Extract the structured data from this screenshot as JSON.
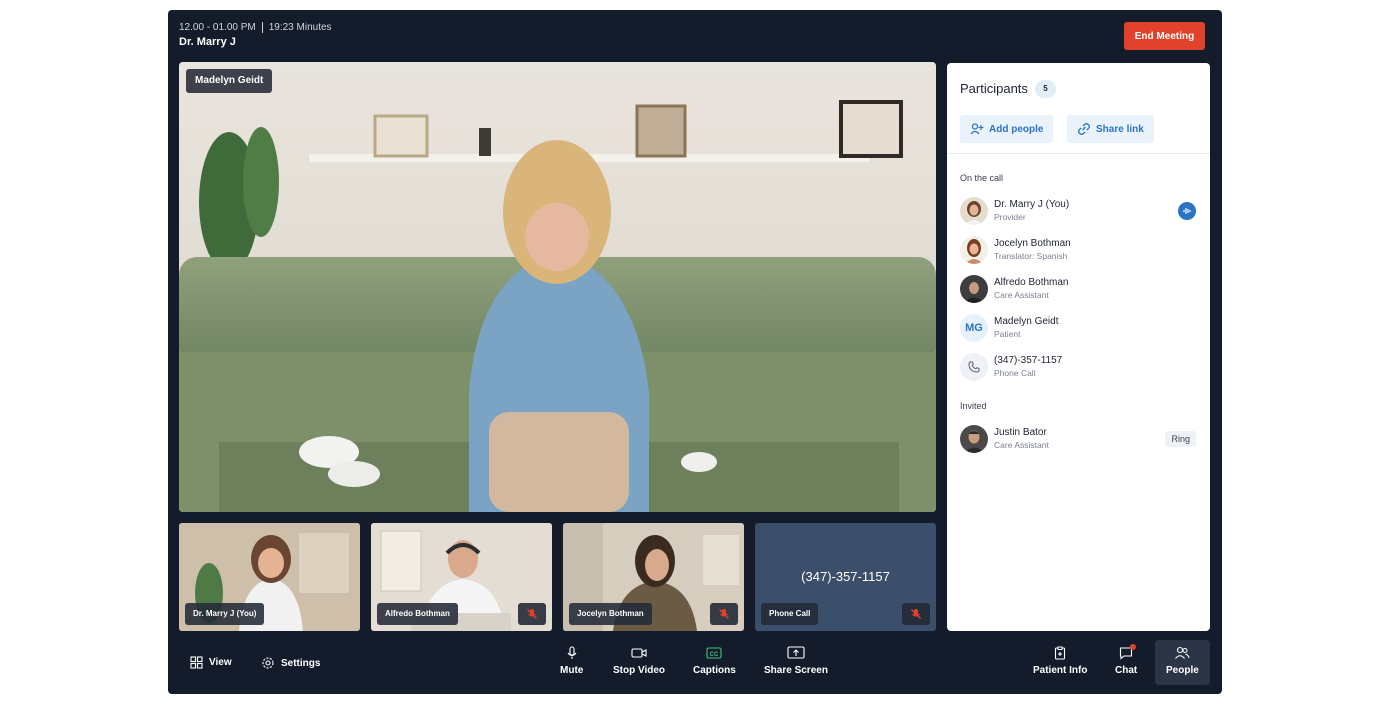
{
  "header": {
    "time_range": "12.00 - 01.00 PM",
    "duration": "19:23 Minutes",
    "host": "Dr. Marry J",
    "end_button": "End Meeting"
  },
  "main_video": {
    "name": "Madelyn Geidt"
  },
  "thumbnails": [
    {
      "name": "Dr. Marry J (You)",
      "muted": false
    },
    {
      "name": "Alfredo Bothman",
      "muted": true
    },
    {
      "name": "Jocelyn Bothman",
      "muted": true
    },
    {
      "name": "Phone Call",
      "number": "(347)-357-1157",
      "muted": true
    }
  ],
  "panel": {
    "title": "Participants",
    "count": "5",
    "add_people": "Add people",
    "share_link": "Share link",
    "on_call_label": "On the call",
    "on_call": [
      {
        "name": "Dr. Marry J (You)",
        "role": "Provider"
      },
      {
        "name": "Jocelyn Bothman",
        "role": "Translator: Spanish"
      },
      {
        "name": "Alfredo Bothman",
        "role": "Care Assistant"
      },
      {
        "name": "Madelyn Geidt",
        "role": "Patient",
        "initials": "MG"
      },
      {
        "name": "(347)-357-1157",
        "role": "Phone Call"
      }
    ],
    "invited_label": "Invited",
    "invited": [
      {
        "name": "Justin Bator",
        "role": "Care Assistant",
        "action": "Ring"
      }
    ]
  },
  "toolbar": {
    "view": "View",
    "settings": "Settings",
    "mute": "Mute",
    "stop_video": "Stop Video",
    "captions": "Captions",
    "share_screen": "Share Screen",
    "patient_info": "Patient Info",
    "chat": "Chat",
    "people": "People"
  },
  "colors": {
    "app_bg": "#141c2c",
    "accent_red": "#e2412b",
    "accent_blue": "#2a74c6",
    "captions_green": "#3ec27a"
  }
}
